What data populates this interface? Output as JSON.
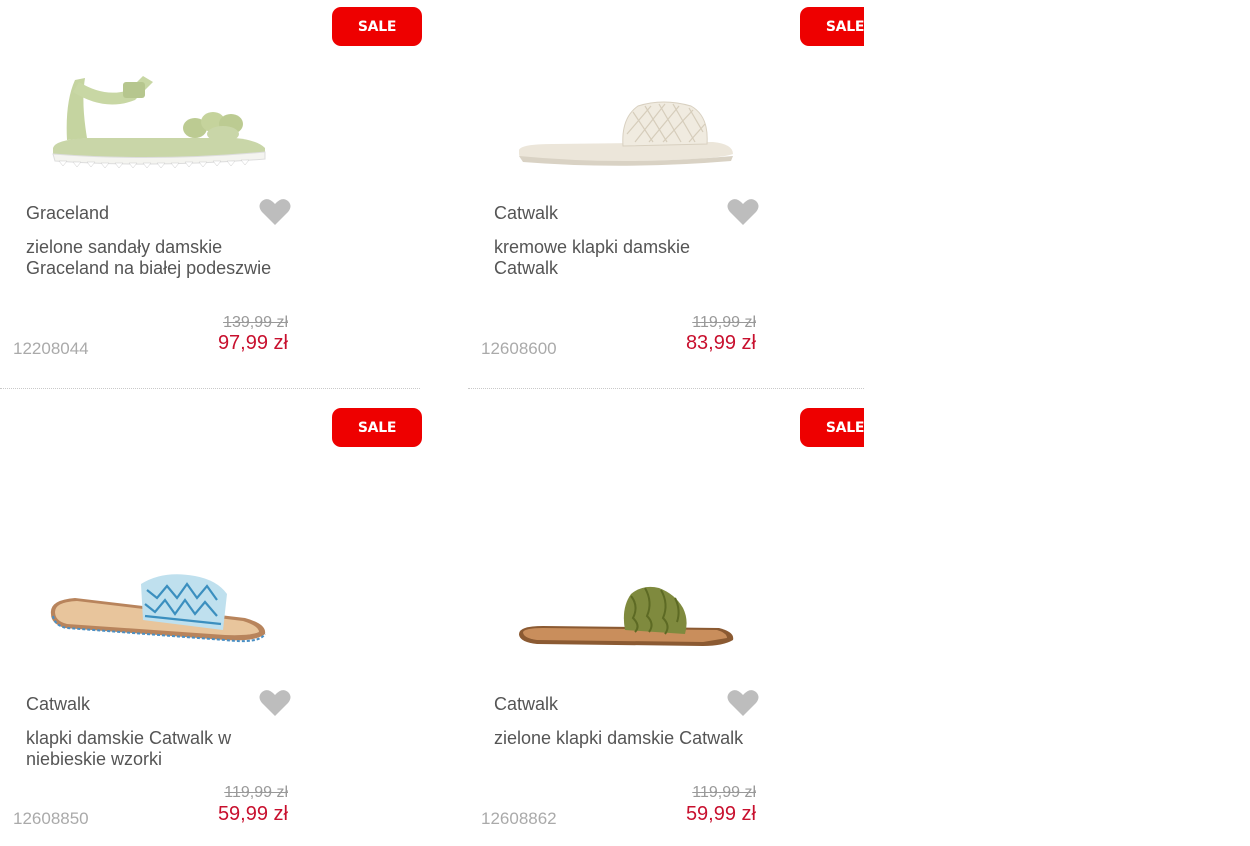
{
  "products": [
    {
      "badge": "SALE",
      "brand": "Graceland",
      "name": "zielone sandały damskie Graceland na białej podeszwie",
      "sku": "12208044",
      "old_price": "139,99 zł",
      "new_price": "97,99 zł",
      "image_icon": "green-sandal-image"
    },
    {
      "badge": "SALE",
      "brand": "Catwalk",
      "name": "kremowe klapki damskie Catwalk",
      "sku": "12608600",
      "old_price": "119,99 zł",
      "new_price": "83,99 zł",
      "image_icon": "cream-slide-image"
    },
    {
      "badge": "SALE",
      "brand": "Catwalk",
      "name": "klapki damskie Catwalk w niebieskie wzorki",
      "sku": "12608850",
      "old_price": "119,99 zł",
      "new_price": "59,99 zł",
      "image_icon": "blue-pattern-slide-image"
    },
    {
      "badge": "SALE",
      "brand": "Catwalk",
      "name": "zielone klapki damskie Catwalk",
      "sku": "12608862",
      "old_price": "119,99 zł",
      "new_price": "59,99 zł",
      "image_icon": "green-ruffle-slide-image"
    }
  ],
  "colors": {
    "sale": "#ee0000",
    "price": "#c8102e",
    "heart": "#bdbdbd"
  }
}
